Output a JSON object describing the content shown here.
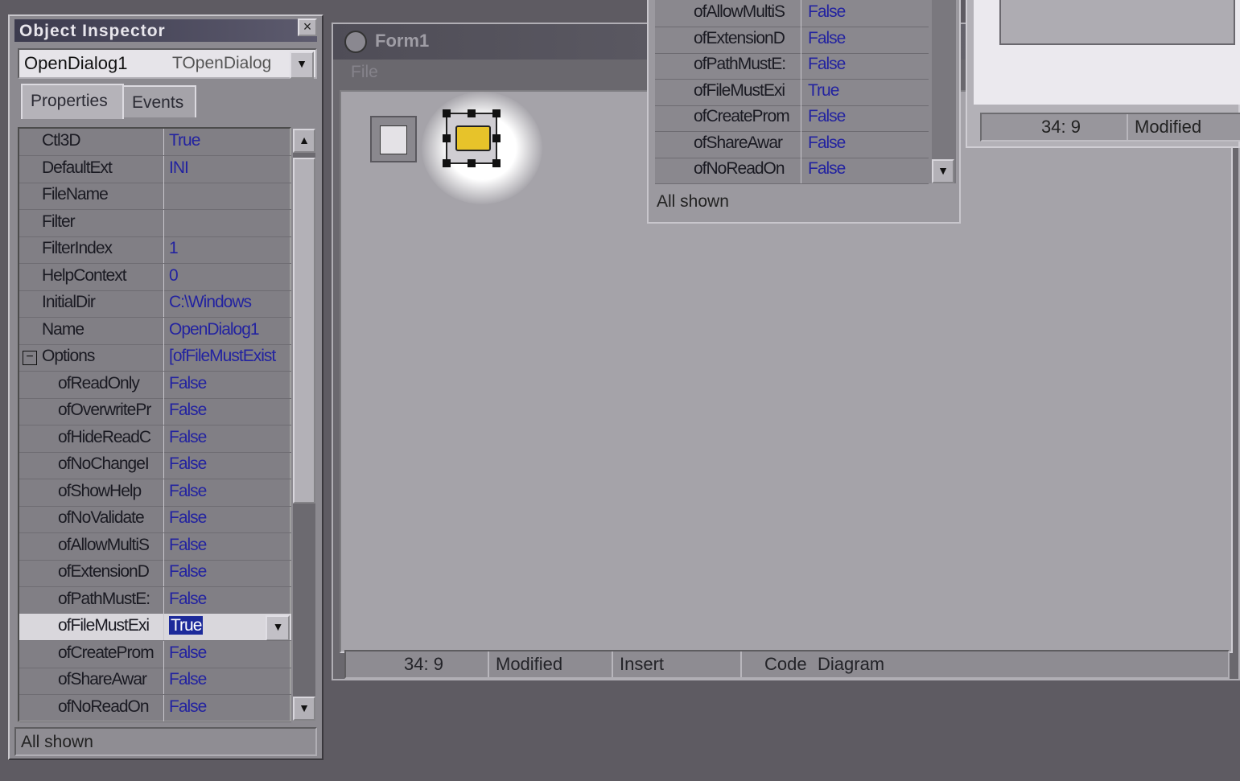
{
  "object_inspector": {
    "title": "Object Inspector",
    "close_glyph": "×",
    "selected_object": "OpenDialog1",
    "selected_type": "TOpenDialog",
    "tabs": [
      "Properties",
      "Events"
    ],
    "rows": [
      {
        "name": "Ctl3D",
        "value": "True"
      },
      {
        "name": "DefaultExt",
        "value": "INI"
      },
      {
        "name": "FileName",
        "value": ""
      },
      {
        "name": "Filter",
        "value": ""
      },
      {
        "name": "FilterIndex",
        "value": "1"
      },
      {
        "name": "HelpContext",
        "value": "0"
      },
      {
        "name": "InitialDir",
        "value": "C:\\Windows"
      },
      {
        "name": "Name",
        "value": "OpenDialog1"
      },
      {
        "name": "Options",
        "value": "[ofFileMustExist"
      },
      {
        "name": "ofReadOnly",
        "value": "False"
      },
      {
        "name": "ofOverwritePr",
        "value": "False"
      },
      {
        "name": "ofHideReadC",
        "value": "False"
      },
      {
        "name": "ofNoChangeI",
        "value": "False"
      },
      {
        "name": "ofShowHelp",
        "value": "False"
      },
      {
        "name": "ofNoValidate",
        "value": "False"
      },
      {
        "name": "ofAllowMultiS",
        "value": "False"
      },
      {
        "name": "ofExtensionD",
        "value": "False"
      },
      {
        "name": "ofPathMustE:",
        "value": "False"
      },
      {
        "name": "ofFileMustExi",
        "value": "True"
      },
      {
        "name": "ofCreateProm",
        "value": "False"
      },
      {
        "name": "ofShareAwar",
        "value": "False"
      },
      {
        "name": "ofNoReadOn",
        "value": "False"
      }
    ],
    "status": "All shown"
  },
  "form1": {
    "title": "Form1",
    "menu": "File",
    "status": {
      "position": "34:   9",
      "modified": "Modified",
      "mode": "Insert",
      "tab_code": "Code",
      "tab_diagram": "Diagram"
    }
  },
  "panel2": {
    "rows": [
      {
        "name": "ofAllowMultiS",
        "value": "False"
      },
      {
        "name": "ofExtensionD",
        "value": "False"
      },
      {
        "name": "ofPathMustE:",
        "value": "False"
      },
      {
        "name": "ofFileMustExi",
        "value": "True"
      },
      {
        "name": "ofCreateProm",
        "value": "False"
      },
      {
        "name": "ofShareAwar",
        "value": "False"
      },
      {
        "name": "ofNoReadOn",
        "value": "False"
      }
    ],
    "status": "All shown"
  },
  "right_editor": {
    "position": "34:   9",
    "modified": "Modified"
  }
}
